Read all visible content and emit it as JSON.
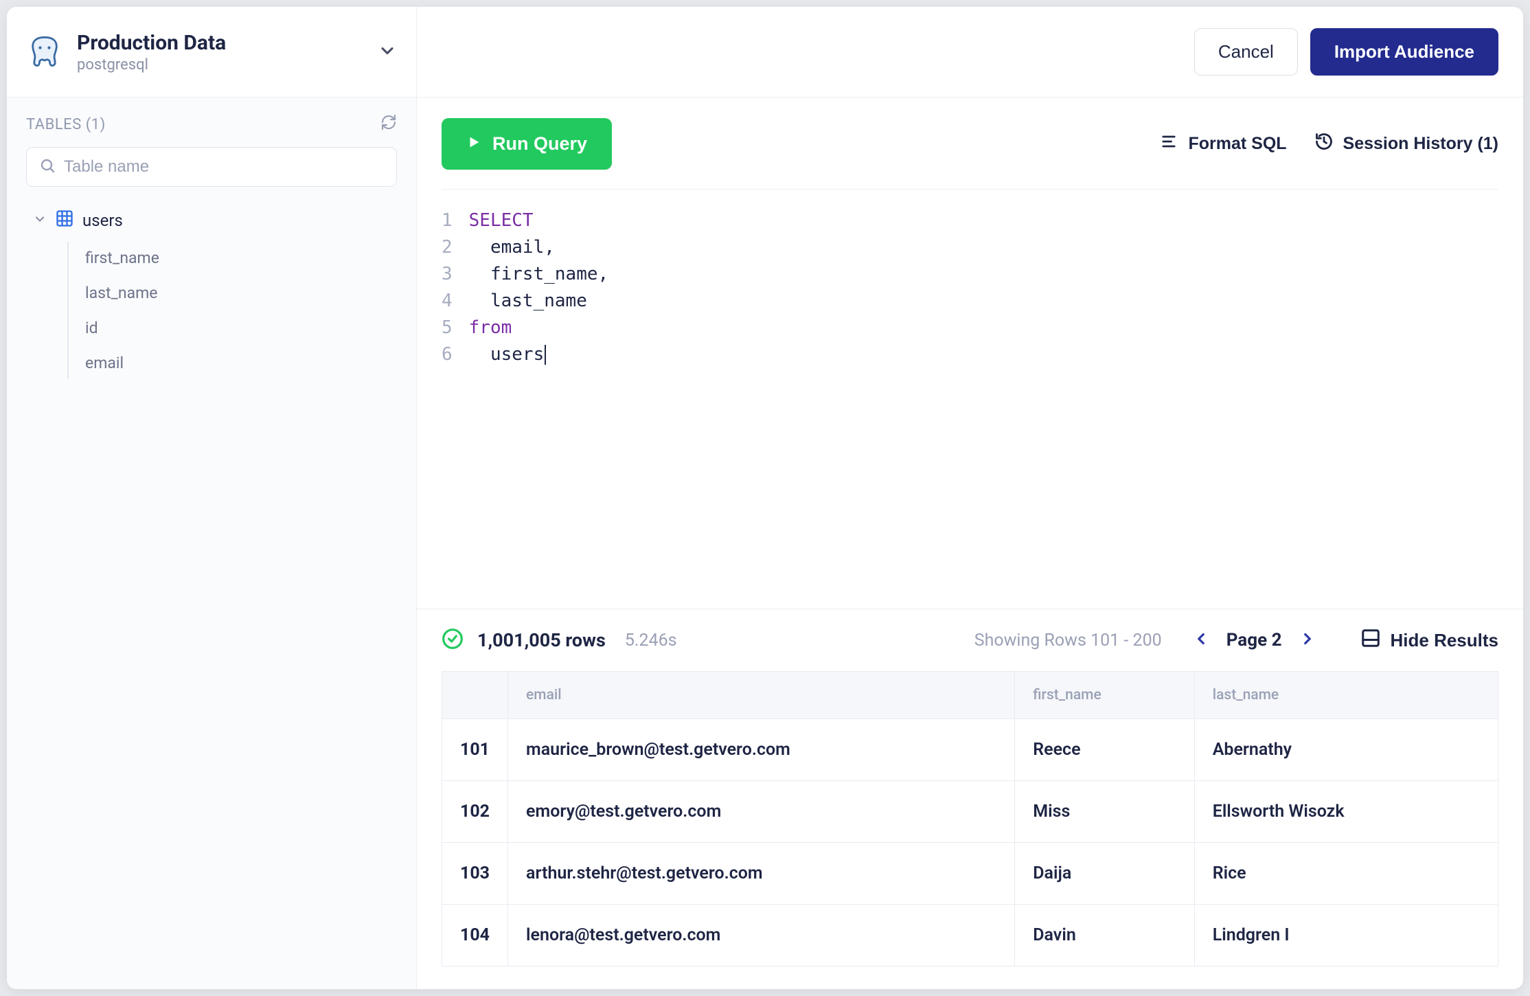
{
  "header": {
    "db_title": "Production Data",
    "db_subtitle": "postgresql",
    "cancel_label": "Cancel",
    "import_label": "Import Audience"
  },
  "sidebar": {
    "tables_header": "TABLES (1)",
    "search_placeholder": "Table name",
    "table_name": "users",
    "columns": [
      "first_name",
      "last_name",
      "id",
      "email"
    ]
  },
  "toolbar": {
    "run_label": "Run Query",
    "format_label": "Format SQL",
    "history_label": "Session History (1)"
  },
  "editor": {
    "lines": [
      {
        "n": "1",
        "segments": [
          {
            "t": "SELECT",
            "cls": "kw"
          }
        ]
      },
      {
        "n": "2",
        "segments": [
          {
            "t": "  email,",
            "cls": ""
          }
        ]
      },
      {
        "n": "3",
        "segments": [
          {
            "t": "  first_name,",
            "cls": ""
          }
        ]
      },
      {
        "n": "4",
        "segments": [
          {
            "t": "  last_name",
            "cls": ""
          }
        ]
      },
      {
        "n": "5",
        "segments": [
          {
            "t": "from",
            "cls": "kw"
          }
        ]
      },
      {
        "n": "6",
        "segments": [
          {
            "t": "  users",
            "cls": ""
          }
        ],
        "cursor": true
      }
    ]
  },
  "results": {
    "row_count": "1,001,005 rows",
    "timing": "5.246s",
    "showing": "Showing Rows 101 - 200",
    "page_label": "Page 2",
    "hide_label": "Hide Results",
    "columns": [
      "email",
      "first_name",
      "last_name"
    ],
    "rows": [
      {
        "n": "101",
        "cells": [
          "maurice_brown@test.getvero.com",
          "Reece",
          "Abernathy"
        ]
      },
      {
        "n": "102",
        "cells": [
          "emory@test.getvero.com",
          "Miss",
          "Ellsworth Wisozk"
        ]
      },
      {
        "n": "103",
        "cells": [
          "arthur.stehr@test.getvero.com",
          "Daija",
          "Rice"
        ]
      },
      {
        "n": "104",
        "cells": [
          "lenora@test.getvero.com",
          "Davin",
          "Lindgren I"
        ]
      }
    ]
  }
}
